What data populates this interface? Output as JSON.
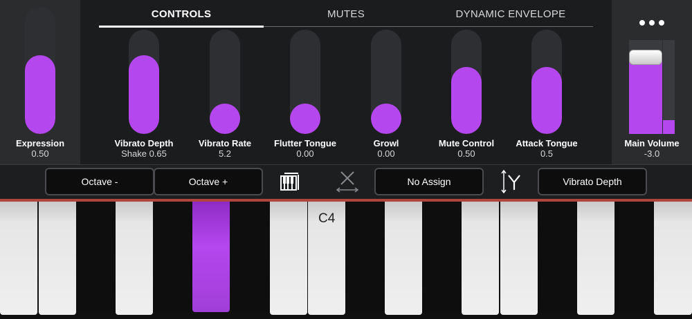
{
  "tabs": [
    {
      "label": "CONTROLS",
      "active": true
    },
    {
      "label": "MUTES",
      "active": false
    },
    {
      "label": "DYNAMIC ENVELOPE",
      "active": false
    }
  ],
  "expression": {
    "label": "Expression",
    "value": "0.50",
    "level": 0.5
  },
  "controls": [
    {
      "label": "Vibrato Depth",
      "value": "Shake 0.65",
      "level": 0.65
    },
    {
      "label": "Vibrato Rate",
      "value": "5.2",
      "level": 0.0
    },
    {
      "label": "Flutter Tongue",
      "value": "0.00",
      "level": 0.0
    },
    {
      "label": "Growl",
      "value": "0.00",
      "level": 0.0
    },
    {
      "label": "Mute Control",
      "value": "0.50",
      "level": 0.5
    },
    {
      "label": "Attack Tongue",
      "value": "0.5",
      "level": 0.5
    }
  ],
  "main_volume": {
    "label": "Main Volume",
    "value": "-3.0",
    "level": 0.82,
    "meter_level": 0.15
  },
  "toolbar": {
    "octave_down": "Octave -",
    "octave_up": "Octave +",
    "x_assign": "No Assign",
    "y_assign": "Vibrato Depth",
    "keyboard_icon": "keyboard-icon",
    "x_axis_icon": "x-axis-icon",
    "y_axis_icon": "y-axis-icon"
  },
  "keyboard": {
    "c4_label": "C4",
    "pressed_key": "A3"
  },
  "colors": {
    "accent": "#b547ee",
    "background": "#1b1c1e",
    "panel": "#2b2c2e",
    "track": "#2d2f33",
    "key_line": "#b0453d"
  }
}
